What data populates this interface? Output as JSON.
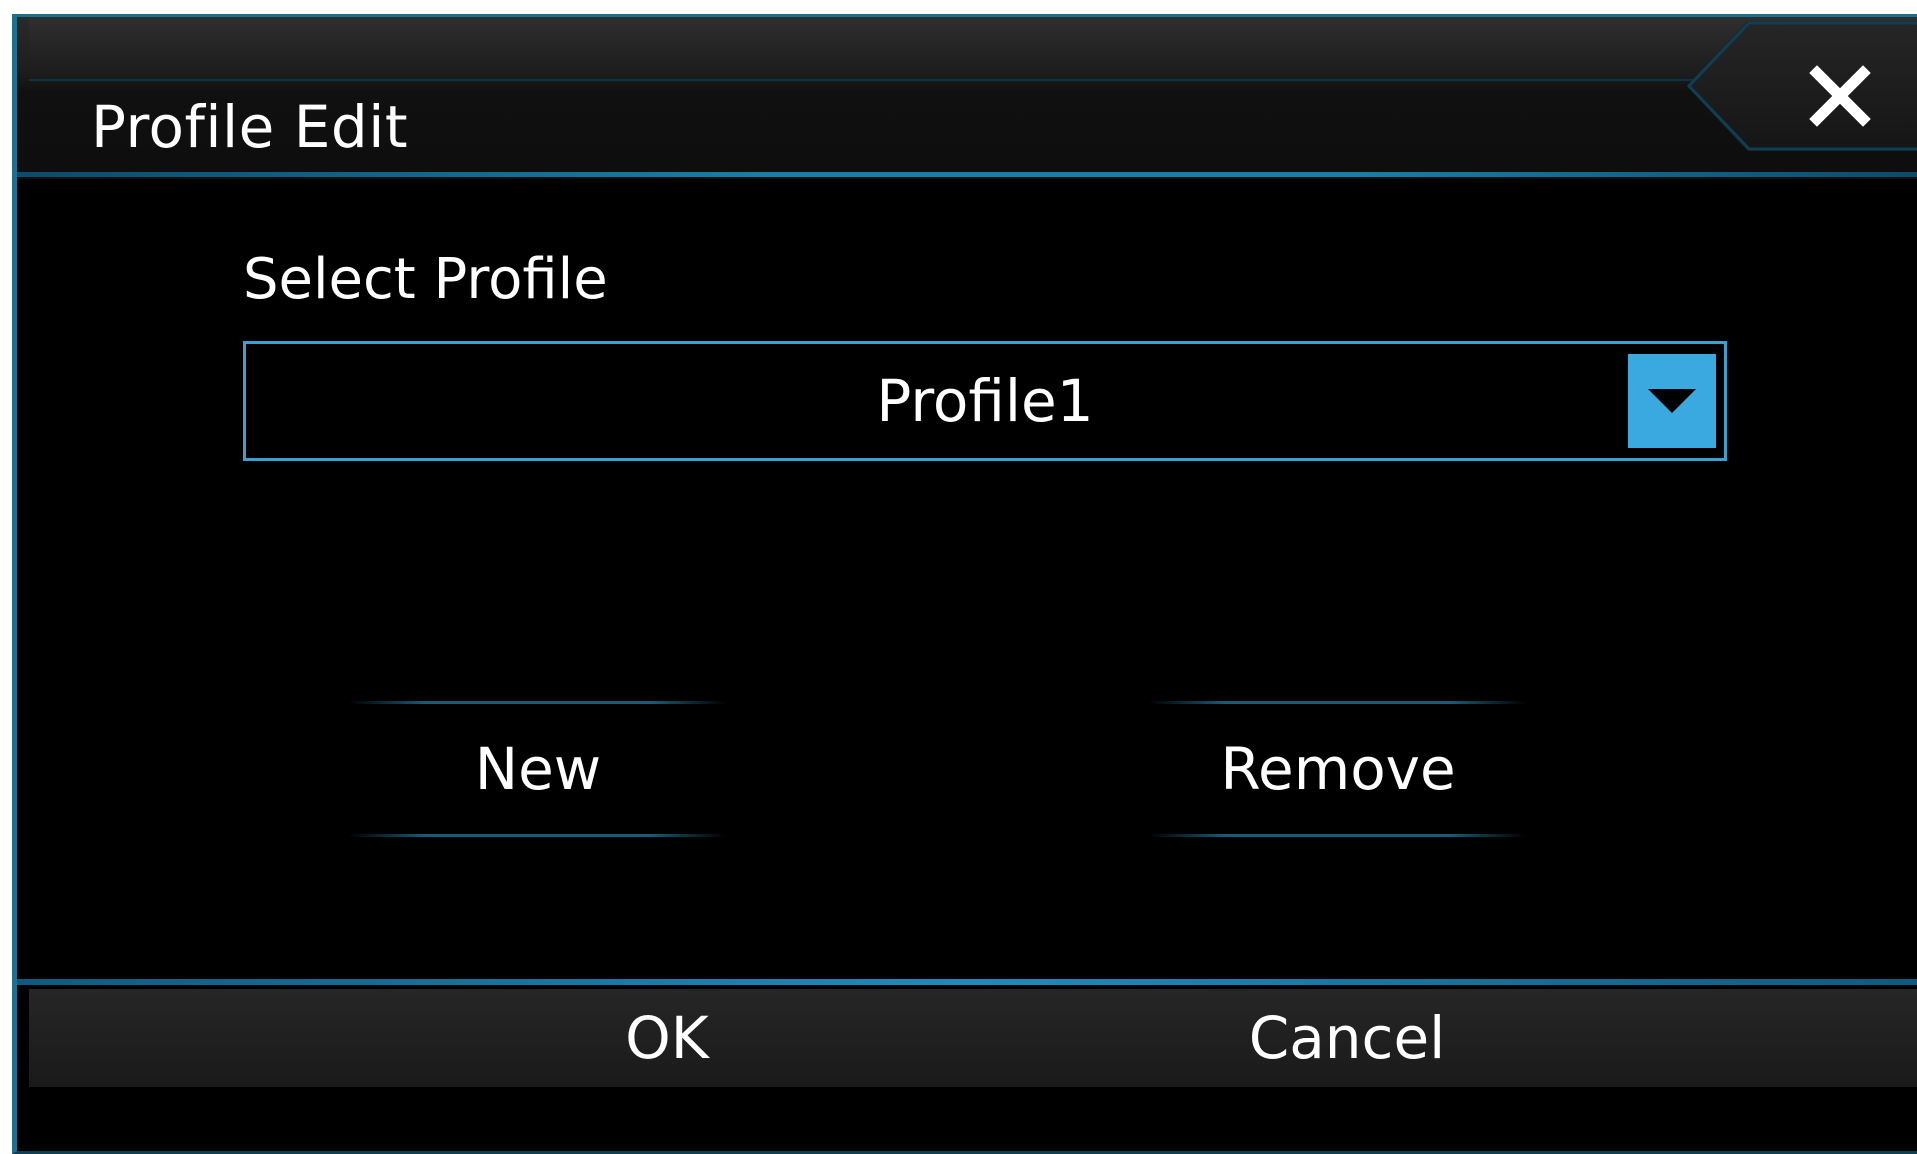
{
  "dialog": {
    "title": "Profile Edit",
    "close_icon": "close-icon"
  },
  "profile": {
    "label": "Select Profile",
    "selected": "Profile1",
    "dropdown_icon": "chevron-down-icon"
  },
  "actions": {
    "new_label": "New",
    "remove_label": "Remove"
  },
  "footer": {
    "ok_label": "OK",
    "cancel_label": "Cancel"
  },
  "colors": {
    "accent": "#3aa9e0",
    "border": "#1f6f8f",
    "background": "#000000",
    "text": "#ffffff"
  }
}
